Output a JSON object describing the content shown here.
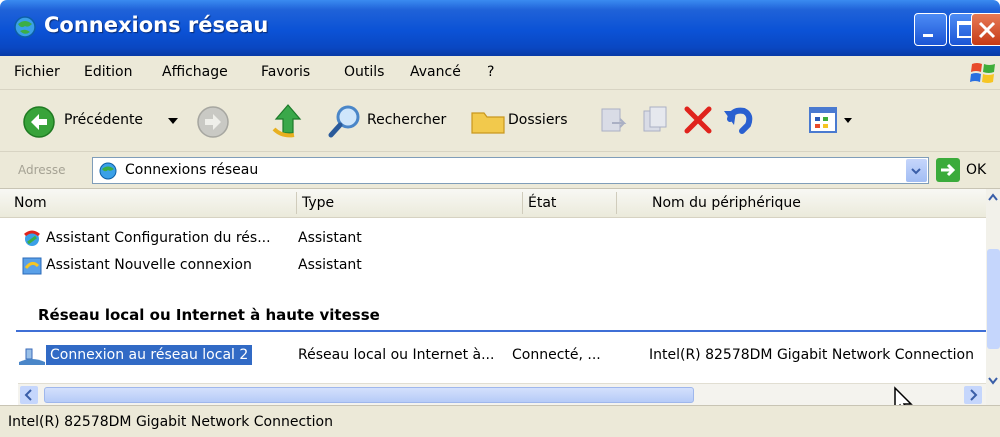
{
  "window": {
    "title": "Connexions réseau",
    "buttons": [
      "minimize-button",
      "maximize-button",
      "close-button"
    ]
  },
  "menu": {
    "items": [
      "Fichier",
      "Edition",
      "Affichage",
      "Favoris",
      "Outils",
      "Avancé",
      "?"
    ]
  },
  "toolbar": {
    "back_label": "Précédente",
    "search_label": "Rechercher",
    "folders_label": "Dossiers"
  },
  "address": {
    "label": "Adresse",
    "value": "Connexions réseau",
    "go_label": "OK"
  },
  "columns": [
    "Nom",
    "Type",
    "État",
    "Nom du périphérique"
  ],
  "items": [
    {
      "name": "Assistant Configuration du rés...",
      "type": "Assistant",
      "icon": "wizard-icon"
    },
    {
      "name": "Assistant Nouvelle connexion",
      "type": "Assistant",
      "icon": "new-connection-wizard-icon"
    }
  ],
  "group": {
    "title": "Réseau local ou Internet à haute vitesse",
    "connection": {
      "name": "Connexion au réseau local 2",
      "type": "Réseau local ou Internet à...",
      "state": "Connecté, ...",
      "device": "Intel(R) 82578DM Gigabit Network Connection"
    }
  },
  "status": {
    "text": "Intel(R) 82578DM Gigabit Network Connection"
  },
  "colors": {
    "titlebar": "#0b52d6",
    "selection": "#316ac5",
    "chrome": "#ece9d8"
  }
}
